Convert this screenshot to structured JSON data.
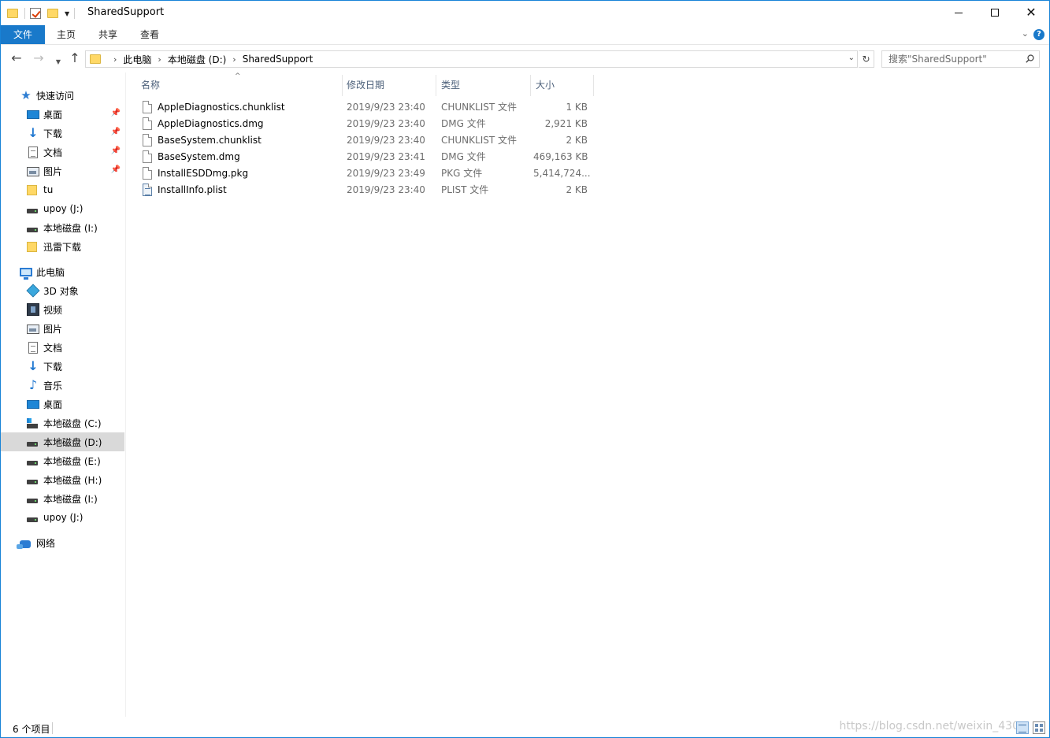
{
  "window": {
    "title": "SharedSupport",
    "accent_color": "#1979ca"
  },
  "ribbon": {
    "tabs": [
      "文件",
      "主页",
      "共享",
      "查看"
    ]
  },
  "address": {
    "crumbs": [
      "此电脑",
      "本地磁盘 (D:)",
      "SharedSupport"
    ],
    "search_placeholder": "搜索\"SharedSupport\""
  },
  "nav": {
    "quick_access": "快速访问",
    "quick_items": [
      {
        "label": "桌面",
        "icon": "desktop-icon",
        "pinned": true
      },
      {
        "label": "下载",
        "icon": "download-icon",
        "pinned": true
      },
      {
        "label": "文档",
        "icon": "document-icon",
        "pinned": true
      },
      {
        "label": "图片",
        "icon": "picture-icon",
        "pinned": true
      },
      {
        "label": "tu",
        "icon": "folder-icon",
        "pinned": false
      },
      {
        "label": "upoy (J:)",
        "icon": "drive-icon",
        "pinned": false
      },
      {
        "label": "本地磁盘 (I:)",
        "icon": "drive-icon",
        "pinned": false
      },
      {
        "label": "迅雷下载",
        "icon": "folder-icon",
        "pinned": false
      }
    ],
    "this_pc": "此电脑",
    "pc_items": [
      {
        "label": "3D 对象",
        "icon": "3d-objects-icon"
      },
      {
        "label": "视频",
        "icon": "video-icon"
      },
      {
        "label": "图片",
        "icon": "picture-icon"
      },
      {
        "label": "文档",
        "icon": "document-icon"
      },
      {
        "label": "下载",
        "icon": "download-icon"
      },
      {
        "label": "音乐",
        "icon": "music-icon"
      },
      {
        "label": "桌面",
        "icon": "desktop-icon"
      },
      {
        "label": "本地磁盘 (C:)",
        "icon": "system-drive-icon"
      },
      {
        "label": "本地磁盘 (D:)",
        "icon": "drive-icon",
        "selected": true
      },
      {
        "label": "本地磁盘 (E:)",
        "icon": "drive-icon"
      },
      {
        "label": "本地磁盘 (H:)",
        "icon": "drive-icon"
      },
      {
        "label": "本地磁盘 (I:)",
        "icon": "drive-icon"
      },
      {
        "label": "upoy (J:)",
        "icon": "drive-icon"
      }
    ],
    "network": "网络"
  },
  "columns": {
    "name": "名称",
    "date": "修改日期",
    "type": "类型",
    "size": "大小"
  },
  "files": [
    {
      "name": "AppleDiagnostics.chunklist",
      "date": "2019/9/23 23:40",
      "type": "CHUNKLIST 文件",
      "size": "1 KB",
      "icon": "file-icon"
    },
    {
      "name": "AppleDiagnostics.dmg",
      "date": "2019/9/23 23:40",
      "type": "DMG 文件",
      "size": "2,921 KB",
      "icon": "file-icon"
    },
    {
      "name": "BaseSystem.chunklist",
      "date": "2019/9/23 23:40",
      "type": "CHUNKLIST 文件",
      "size": "2 KB",
      "icon": "file-icon"
    },
    {
      "name": "BaseSystem.dmg",
      "date": "2019/9/23 23:41",
      "type": "DMG 文件",
      "size": "469,163 KB",
      "icon": "file-icon"
    },
    {
      "name": "InstallESDDmg.pkg",
      "date": "2019/9/23 23:49",
      "type": "PKG 文件",
      "size": "5,414,724...",
      "icon": "file-icon"
    },
    {
      "name": "InstallInfo.plist",
      "date": "2019/9/23 23:40",
      "type": "PLIST 文件",
      "size": "2 KB",
      "icon": "plist-file-icon"
    }
  ],
  "status": {
    "item_count": "6 个项目",
    "watermark": "https://blog.csdn.net/weixin_430"
  }
}
